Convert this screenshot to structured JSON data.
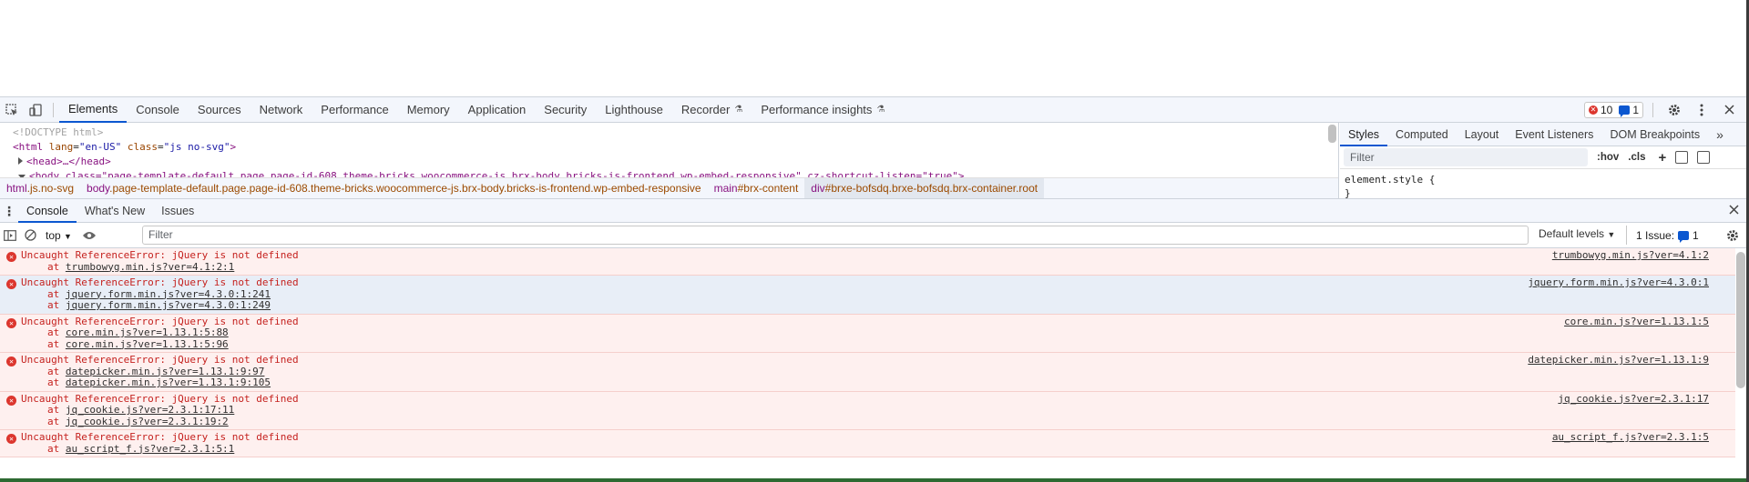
{
  "toolbar": {
    "tabs": [
      {
        "label": "Elements",
        "active": true
      },
      {
        "label": "Console"
      },
      {
        "label": "Sources"
      },
      {
        "label": "Network"
      },
      {
        "label": "Performance"
      },
      {
        "label": "Memory"
      },
      {
        "label": "Application"
      },
      {
        "label": "Security"
      },
      {
        "label": "Lighthouse"
      },
      {
        "label": "Recorder",
        "experimental": true
      },
      {
        "label": "Performance insights",
        "experimental": true
      }
    ],
    "error_count": "10",
    "message_count": "1"
  },
  "elements": {
    "doctype": "<!DOCTYPE html>",
    "html_open_tag": "<html",
    "html_lang_attr": "lang",
    "html_lang_val": "\"en-US\"",
    "html_class_attr": "class",
    "html_class_val": "\"js no-svg\"",
    "html_close": ">",
    "head_text": "<head>…</head>",
    "body_line": "<body class=\"page-template-default page page-id-608 theme-bricks woocommerce-js brx-body bricks-is-frontend wp-embed-responsive\" cz-shortcut-listen=\"true\">",
    "breadcrumbs": [
      {
        "tag": "html",
        "rest": ".js.no-svg"
      },
      {
        "tag": "body",
        "rest": ".page-template-default.page.page-id-608.theme-bricks.woocommerce-js.brx-body.bricks-is-frontend.wp-embed-responsive"
      },
      {
        "tag": "main",
        "rest": "#brx-content"
      },
      {
        "tag": "div",
        "rest": "#brxe-bofsdq.brxe-bofsdq.brx-container.root",
        "selected": true
      }
    ]
  },
  "styles": {
    "tabs": [
      "Styles",
      "Computed",
      "Layout",
      "Event Listeners",
      "DOM Breakpoints"
    ],
    "more": "»",
    "filter_placeholder": "Filter",
    "hov": ":hov",
    "cls": ".cls",
    "plus": "+",
    "element_style": "element.style {",
    "element_style_close": "}"
  },
  "drawer": {
    "tabs": [
      "Console",
      "What's New",
      "Issues"
    ],
    "context": "top",
    "filter_placeholder": "Filter",
    "levels": "Default levels",
    "issues_label": "1 Issue:",
    "issues_count": "1"
  },
  "messages": [
    {
      "text": "Uncaught ReferenceError: jQuery is not defined",
      "stack": [
        "trumbowyg.min.js?ver=4.1:2:1"
      ],
      "source": "trumbowyg.min.js?ver=4.1:2"
    },
    {
      "text": "Uncaught ReferenceError: jQuery is not defined",
      "stack": [
        "jquery.form.min.js?ver=4.3.0:1:241",
        "jquery.form.min.js?ver=4.3.0:1:249"
      ],
      "source": "jquery.form.min.js?ver=4.3.0:1",
      "highlight": true
    },
    {
      "text": "Uncaught ReferenceError: jQuery is not defined",
      "stack": [
        "core.min.js?ver=1.13.1:5:88",
        "core.min.js?ver=1.13.1:5:96"
      ],
      "source": "core.min.js?ver=1.13.1:5"
    },
    {
      "text": "Uncaught ReferenceError: jQuery is not defined",
      "stack": [
        "datepicker.min.js?ver=1.13.1:9:97",
        "datepicker.min.js?ver=1.13.1:9:105"
      ],
      "source": "datepicker.min.js?ver=1.13.1:9"
    },
    {
      "text": "Uncaught ReferenceError: jQuery is not defined",
      "stack": [
        "jq_cookie.js?ver=2.3.1:17:11",
        "jq_cookie.js?ver=2.3.1:19:2"
      ],
      "source": "jq_cookie.js?ver=2.3.1:17"
    },
    {
      "text": "Uncaught ReferenceError: jQuery is not defined",
      "stack": [
        "au_script_f.js?ver=2.3.1:5:1"
      ],
      "source": "au_script_f.js?ver=2.3.1:5"
    }
  ],
  "icons": {
    "inspect": "inspect-element-icon",
    "device": "device-toolbar-icon",
    "settings": "gear-icon",
    "more": "kebab-menu-icon",
    "close": "close-icon"
  },
  "colors": {
    "accent": "#0b57d0",
    "error": "#dc362e",
    "error_bg": "#fef0ef"
  }
}
